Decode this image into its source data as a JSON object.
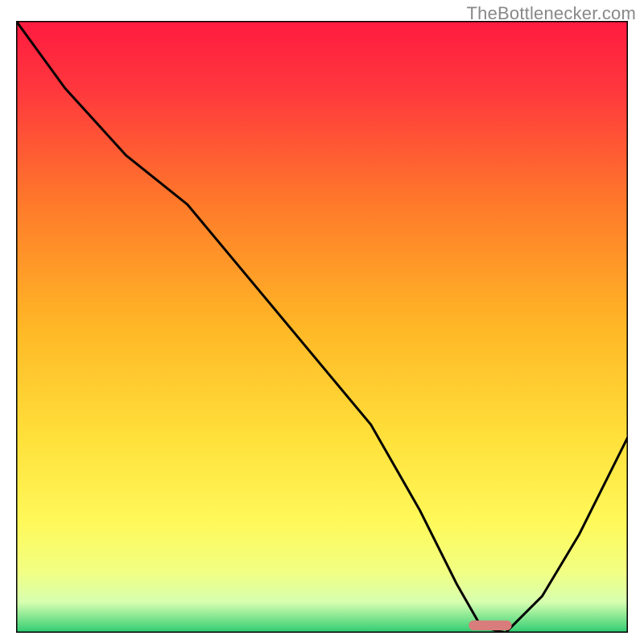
{
  "watermark": "TheBottlenecker.com",
  "chart_data": {
    "type": "line",
    "title": "",
    "xlabel": "",
    "ylabel": "",
    "xlim": [
      0,
      100
    ],
    "ylim": [
      0,
      100
    ],
    "background_gradient": {
      "top": "#ff1a40",
      "upper_mid": "#ff9a1f",
      "mid": "#ffe33a",
      "lower_mid": "#f6ff6b",
      "above_bottom": "#e4ffb2",
      "bottom": "#2ecc71"
    },
    "series": [
      {
        "name": "bottleneck-curve",
        "x": [
          0,
          8,
          18,
          28,
          38,
          48,
          58,
          66,
          72,
          76,
          80,
          86,
          92,
          100
        ],
        "y": [
          100,
          89,
          78,
          70,
          58,
          46,
          34,
          20,
          8,
          1,
          0,
          6,
          16,
          32
        ]
      }
    ],
    "marker": {
      "name": "optimal-zone",
      "x": 77.5,
      "y": 1.2,
      "width": 7,
      "height": 1.6,
      "color": "#d97c7c"
    },
    "frame": {
      "color": "#000000",
      "width": 3
    }
  }
}
